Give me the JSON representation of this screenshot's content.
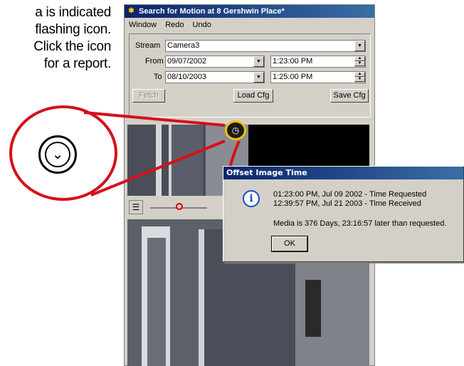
{
  "caption": {
    "lines": [
      "a is indicated",
      "flashing icon.",
      "Click the icon",
      "for a report."
    ]
  },
  "window": {
    "title": "Search for Motion at 8 Gershwin Place*",
    "menu": [
      "Window",
      "Redo",
      "Undo"
    ]
  },
  "form": {
    "stream_label": "Stream",
    "stream_value": "Camera3",
    "from_label": "From",
    "from_date": "09/07/2002",
    "from_time": "1:23:00 PM",
    "to_label": "To",
    "to_date": "08/10/2003",
    "to_time": "1:25:00 PM",
    "fetch_label": "Fetch",
    "load_label": "Load Cfg",
    "save_label": "Save Cfg"
  },
  "dialog": {
    "title": "Offset Image Time",
    "line1": "01:23:00 PM,  Jul 09 2002  - Time Requested",
    "line2": "12:39:57 PM,  Jul 21 2003  - Time Received",
    "message": "Media is 376 Days, 23:16:57 later than requested.",
    "ok_label": "OK"
  },
  "icons": {
    "app": "camera-icon",
    "flash": "clock-icon",
    "info": "info-icon"
  },
  "colors": {
    "callout_red": "#d5101b",
    "highlight_yellow": "#f2c200",
    "title_blue": "#0a246a"
  }
}
